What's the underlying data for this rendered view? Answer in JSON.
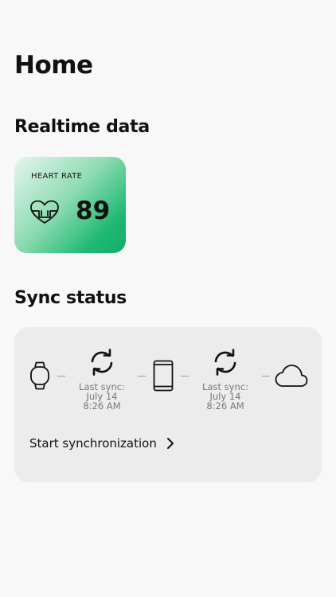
{
  "page": {
    "title": "Home"
  },
  "realtime": {
    "section_title": "Realtime data",
    "heart_rate": {
      "label": "HEART RATE",
      "value": "89",
      "icon": "heart-rate-icon",
      "gradient_colors": [
        "#e6f6ee",
        "#10ad66"
      ]
    }
  },
  "sync": {
    "section_title": "Sync status",
    "devices": [
      {
        "name": "watch",
        "icon": "watch-icon"
      },
      {
        "name": "phone",
        "icon": "phone-icon"
      },
      {
        "name": "cloud",
        "icon": "cloud-icon"
      }
    ],
    "watch_to_phone": {
      "icon": "sync-icon",
      "label": "Last sync:",
      "date": "July 14",
      "time": "8:26 AM"
    },
    "phone_to_cloud": {
      "icon": "sync-icon",
      "label": "Last sync:",
      "date": "July 14",
      "time": "8:26 AM"
    },
    "action": {
      "label": "Start synchronization",
      "icon": "chevron-right-icon"
    }
  }
}
